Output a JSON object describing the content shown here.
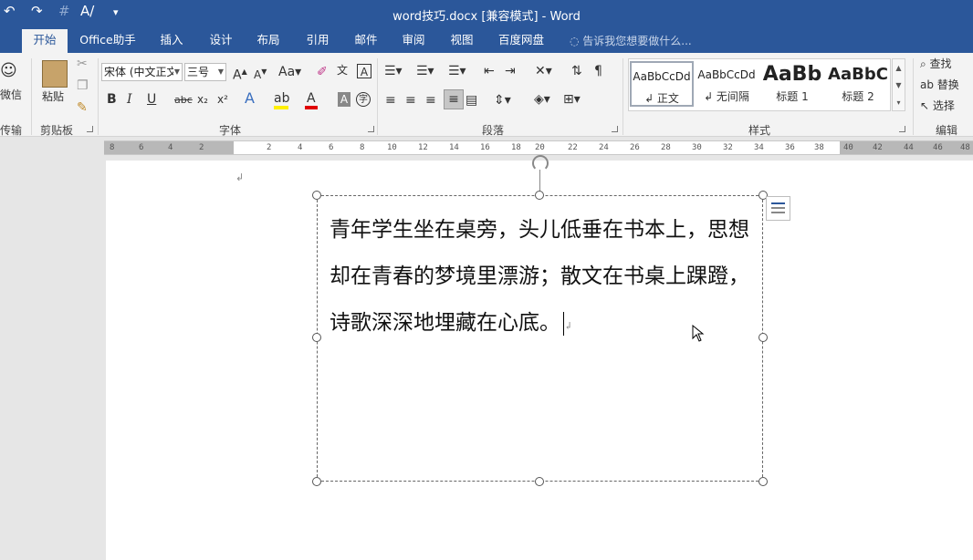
{
  "window": {
    "title": "word技巧.docx [兼容模式] - Word"
  },
  "qat": {
    "undo": "↶",
    "redo": "↷",
    "touch": "#",
    "spell": "A/",
    "more": "▾"
  },
  "tabs": [
    "开始",
    "Office助手",
    "插入",
    "设计",
    "布局",
    "引用",
    "邮件",
    "审阅",
    "视图",
    "百度网盘"
  ],
  "tellme": "告诉我您想要做什么...",
  "groups": {
    "transfer": "传输",
    "transfer_btn": "微信",
    "clipboard": "剪贴板",
    "paste": "粘贴",
    "font": "字体",
    "paragraph": "段落",
    "styles": "样式",
    "editing": "编辑"
  },
  "font": {
    "name": "宋体 (中文正文)",
    "size": "三号"
  },
  "font_buttons": {
    "bold": "B",
    "italic": "I",
    "underline": "U",
    "strike": "abc",
    "sub": "x₂",
    "sup": "x²"
  },
  "styles": [
    {
      "preview": "AaBbCcDd",
      "name": "↲ 正文"
    },
    {
      "preview": "AaBbCcDd",
      "name": "↲ 无间隔"
    },
    {
      "preview": "AaBb",
      "name": "标题 1"
    },
    {
      "preview": "AaBbC",
      "name": "标题 2"
    }
  ],
  "editing": {
    "find": "查找",
    "replace": "替换",
    "select": "选择"
  },
  "ruler_ticks": [
    "8",
    "6",
    "4",
    "2",
    "2",
    "4",
    "6",
    "8",
    "10",
    "12",
    "14",
    "16",
    "18",
    "20",
    "22",
    "24",
    "26",
    "28",
    "30",
    "32",
    "34",
    "36",
    "38",
    "40",
    "42",
    "44",
    "46",
    "48"
  ],
  "document": {
    "para_mark": "↲",
    "textbox_text": "青年学生坐在桌旁，头儿低垂在书本上，思想却在青春的梦境里漂游；散文在书桌上踝蹬，诗歌深深地埋藏在心底。"
  }
}
